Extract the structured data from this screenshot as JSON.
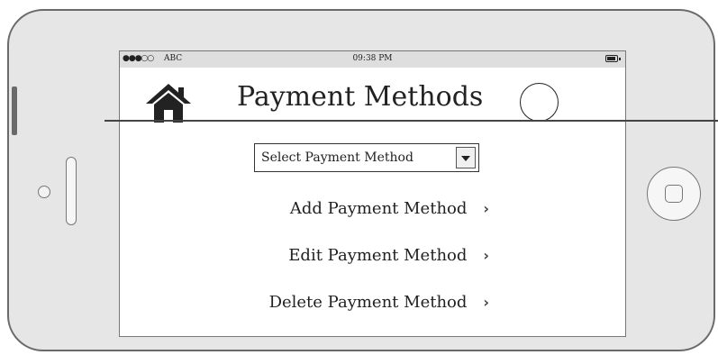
{
  "status_bar": {
    "signal": "●●●○○",
    "carrier": "ABC",
    "time": "09:38 PM"
  },
  "header": {
    "title": "Payment Methods",
    "home_icon": "home-icon",
    "avatar_icon": "avatar"
  },
  "select": {
    "value": "Select Payment Method",
    "arrow_icon": "caret-down-icon"
  },
  "menu": {
    "items": [
      {
        "label": "Add Payment Method",
        "chevron": "›"
      },
      {
        "label": "Edit Payment Method",
        "chevron": "›"
      },
      {
        "label": "Delete Payment Method",
        "chevron": "›"
      }
    ]
  }
}
